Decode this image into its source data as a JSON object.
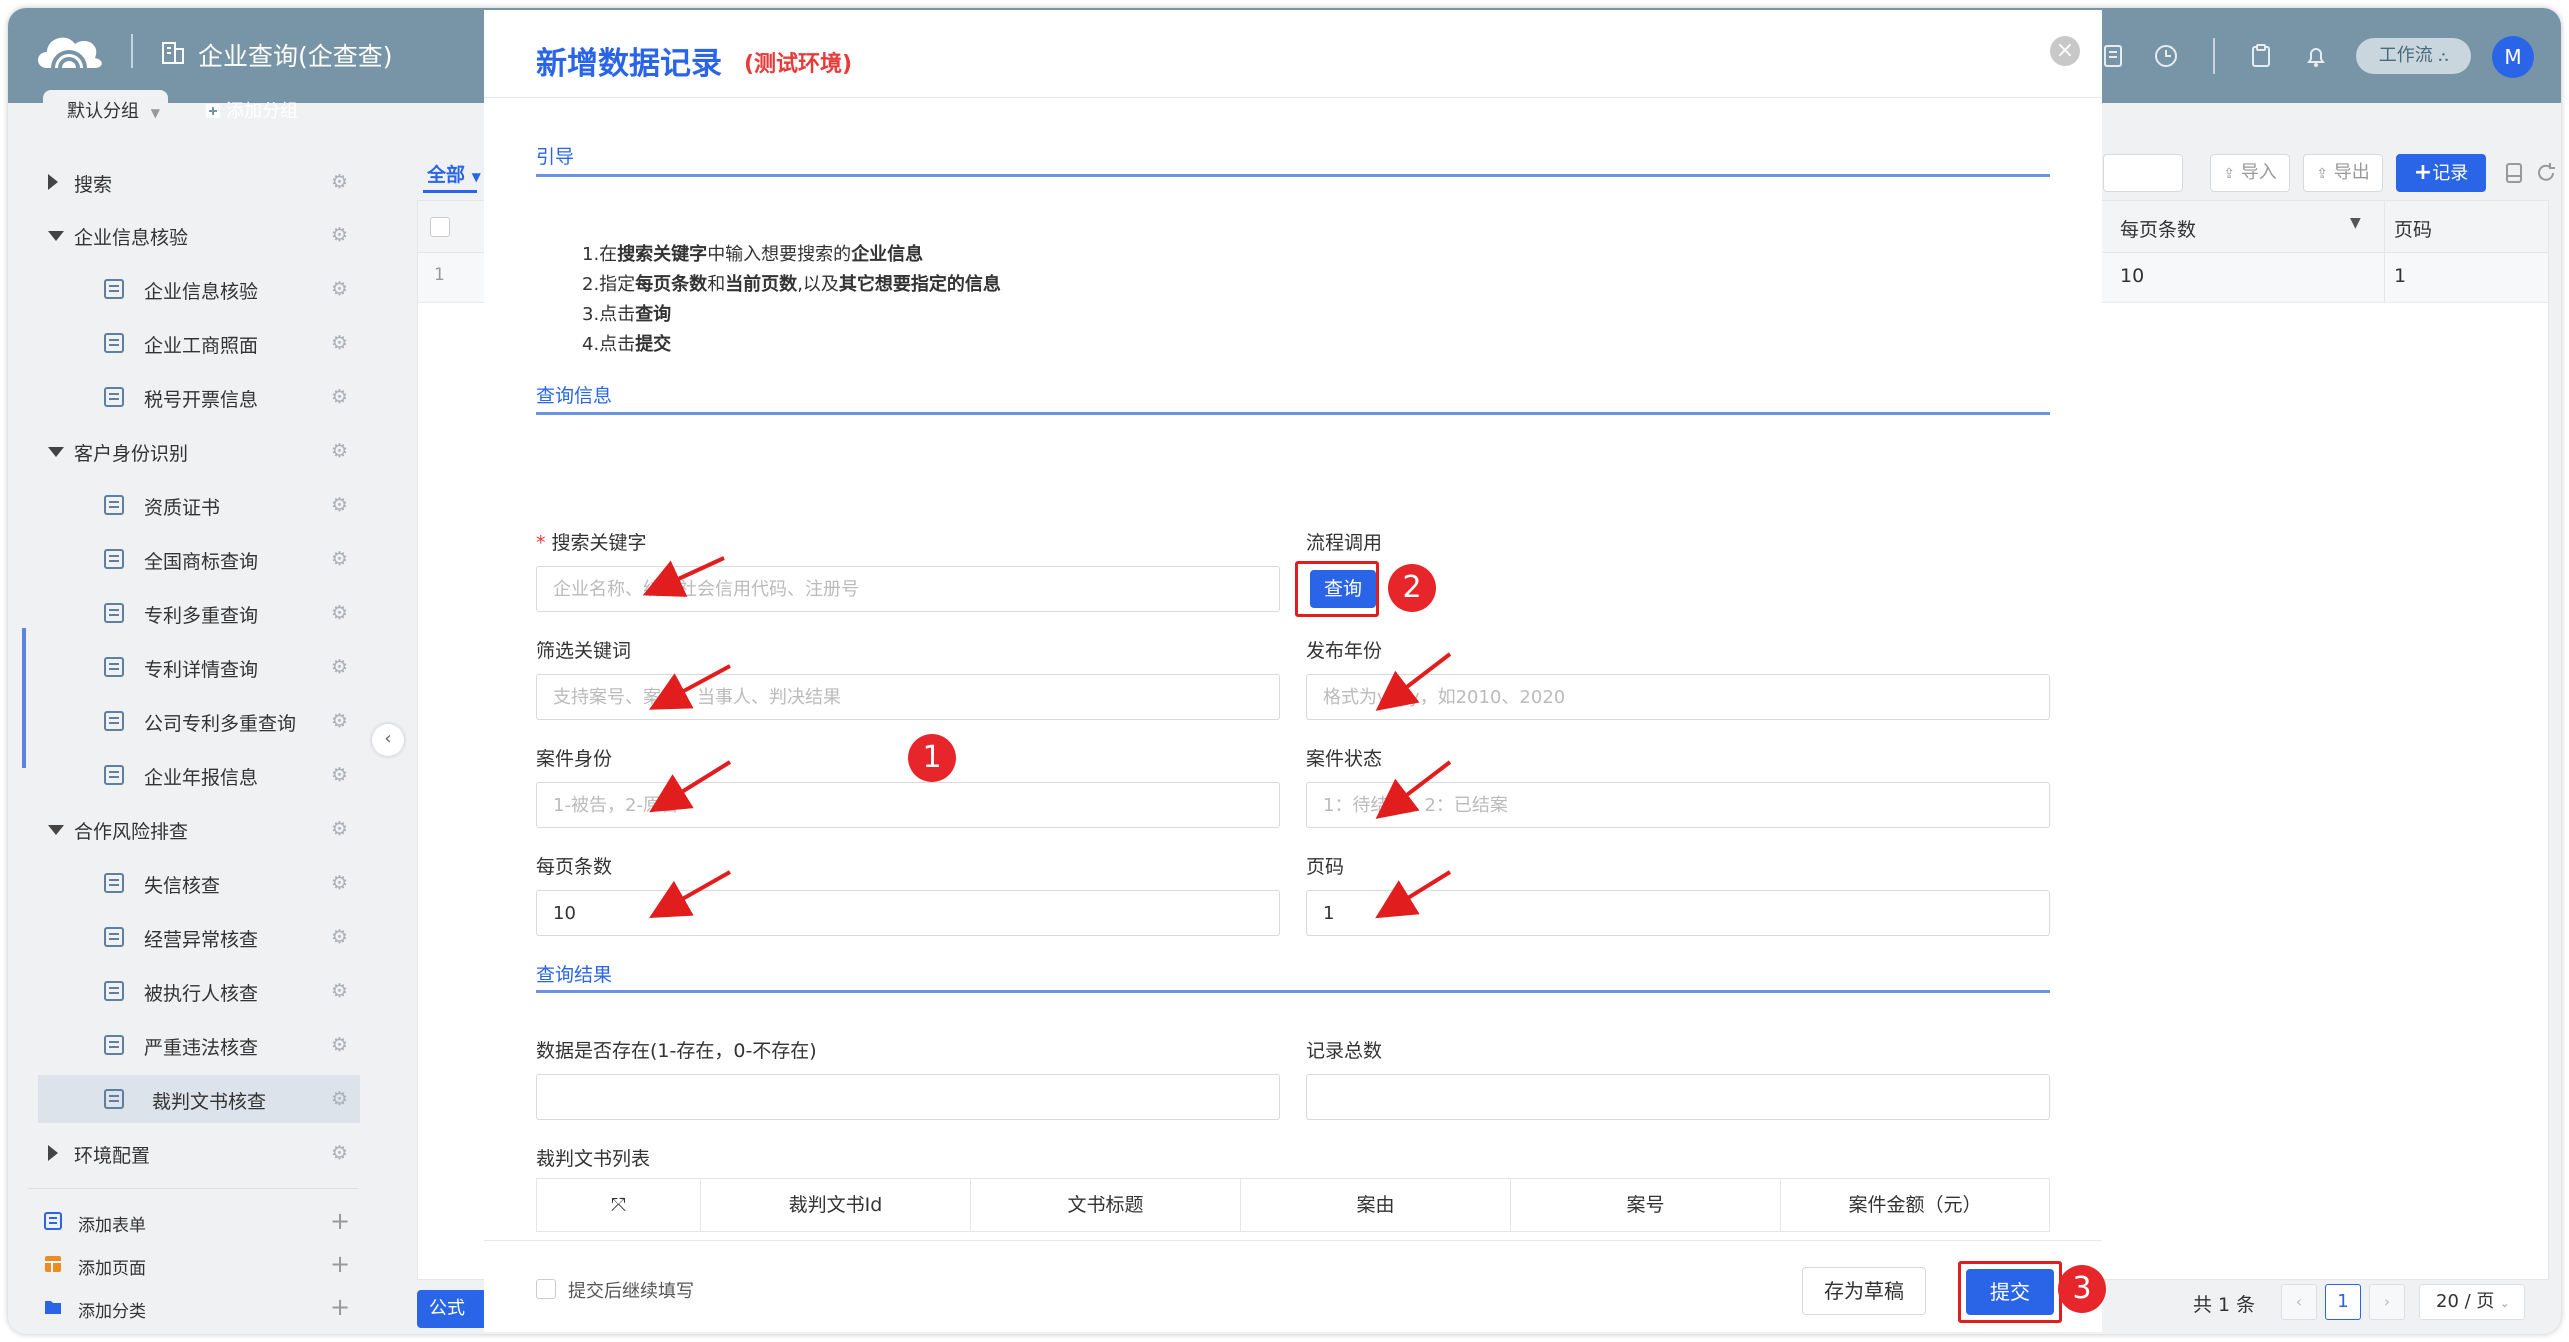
{
  "header": {
    "app_title": "企业查询(企查查)",
    "workflow_label": "工作流",
    "avatar_initial": "M",
    "icons": [
      "doc-list-icon",
      "clock-icon",
      "clipboard-icon",
      "bell-icon"
    ]
  },
  "group_tabs": {
    "default_label": "默认分组",
    "add_label": "添加分组"
  },
  "sidebar": {
    "items": [
      {
        "label": "搜索",
        "level": 0,
        "expanded": false
      },
      {
        "label": "企业信息核验",
        "level": 0,
        "expanded": true
      },
      {
        "label": "企业信息核验",
        "level": 1
      },
      {
        "label": "企业工商照面",
        "level": 1
      },
      {
        "label": "税号开票信息",
        "level": 1
      },
      {
        "label": "客户身份识别",
        "level": 0,
        "expanded": true
      },
      {
        "label": "资质证书",
        "level": 1
      },
      {
        "label": "全国商标查询",
        "level": 1
      },
      {
        "label": "专利多重查询",
        "level": 1
      },
      {
        "label": "专利详情查询",
        "level": 1
      },
      {
        "label": "公司专利多重查询",
        "level": 1
      },
      {
        "label": "企业年报信息",
        "level": 1
      },
      {
        "label": "合作风险排查",
        "level": 0,
        "expanded": true
      },
      {
        "label": "失信核查",
        "level": 1
      },
      {
        "label": "经营异常核查",
        "level": 1
      },
      {
        "label": "被执行人核查",
        "level": 1
      },
      {
        "label": "严重违法核查",
        "level": 1
      },
      {
        "label": "裁判文书核查",
        "level": 1,
        "active": true
      },
      {
        "label": "环境配置",
        "level": 0,
        "expanded": false
      }
    ],
    "footer": [
      {
        "label": "添加表单",
        "icon": "form-icon"
      },
      {
        "label": "添加页面",
        "icon": "page-icon"
      },
      {
        "label": "添加分类",
        "icon": "folder-icon"
      }
    ]
  },
  "main": {
    "filter_label": "全部",
    "toolbar": {
      "import_label": "导入",
      "export_label": "导出",
      "record_label": "记录"
    },
    "table": {
      "columns": [
        "每页条数",
        "页码"
      ],
      "row_index": "1",
      "row": [
        "10",
        "1"
      ]
    },
    "formula_label": "公式",
    "pager": {
      "total": "共 1 条",
      "page": "1",
      "page_size": "20 / 页"
    }
  },
  "modal": {
    "title": "新增数据记录",
    "env_tag": "(测试环境)",
    "sections": {
      "guide": "引导",
      "query": "查询信息",
      "result": "查询结果"
    },
    "guide_steps": [
      [
        {
          "t": "1.在"
        },
        {
          "t": "搜索关键字",
          "b": true
        },
        {
          "t": "中输入想要搜索的"
        },
        {
          "t": "企业信息",
          "b": true
        }
      ],
      [
        {
          "t": "2.指定"
        },
        {
          "t": "每页条数",
          "b": true
        },
        {
          "t": "和"
        },
        {
          "t": "当前页数",
          "b": true
        },
        {
          "t": ",以及"
        },
        {
          "t": "其它想要指定的信息",
          "b": true
        }
      ],
      [
        {
          "t": "3.点击"
        },
        {
          "t": "查询",
          "b": true
        }
      ],
      [
        {
          "t": "4.点击"
        },
        {
          "t": "提交",
          "b": true
        }
      ]
    ],
    "fields": {
      "keyword": {
        "label": "搜索关键字",
        "required": true,
        "placeholder": "企业名称、统一社会信用代码、注册号",
        "value": ""
      },
      "flow_call": {
        "label": "流程调用",
        "button": "查询"
      },
      "filter_keyword": {
        "label": "筛选关键词",
        "placeholder": "支持案号、案由、当事人、判决结果",
        "value": ""
      },
      "publish_year": {
        "label": "发布年份",
        "placeholder": "格式为yyyy，如2010、2020",
        "value": ""
      },
      "case_role": {
        "label": "案件身份",
        "placeholder": "1-被告，2-原告",
        "value": ""
      },
      "case_status": {
        "label": "案件状态",
        "placeholder": "1：待结案，2：已结案",
        "value": ""
      },
      "page_size": {
        "label": "每页条数",
        "value": "10"
      },
      "page_no": {
        "label": "页码",
        "value": "1"
      },
      "data_exists": {
        "label": "数据是否存在(1-存在，0-不存在)",
        "value": ""
      },
      "total_records": {
        "label": "记录总数",
        "value": ""
      }
    },
    "sub_table": {
      "label": "裁判文书列表",
      "expand_icon": "expand-icon",
      "columns": [
        "裁判文书Id",
        "文书标题",
        "案由",
        "案号",
        "案件金额（元）"
      ]
    },
    "footer": {
      "continue_label": "提交后继续填写",
      "draft_label": "存为草稿",
      "submit_label": "提交"
    },
    "badges": [
      "1",
      "2",
      "3"
    ]
  },
  "colors": {
    "header_bg": "#7795a6",
    "accent": "#2a65e8",
    "annotation_red": "#e11d1d",
    "badge_red": "#e7262b"
  }
}
